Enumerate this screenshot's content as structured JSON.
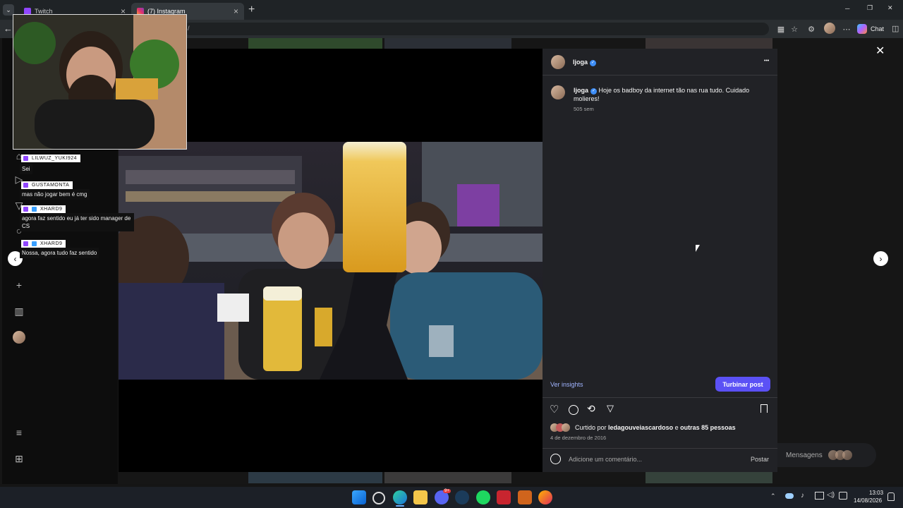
{
  "browser": {
    "tabs": [
      {
        "label": "Twitch"
      },
      {
        "label": "(7) Instagram"
      }
    ],
    "new_tab": "+",
    "url_fragment": "/",
    "chat_label": "Chat",
    "window_controls": {
      "minimize": "─",
      "restore": "❐",
      "close": "✕"
    }
  },
  "stream_chat": [
    {
      "user": "LILWUZ_YUKI924",
      "message": "Sei"
    },
    {
      "user": "GUSTAMONTA",
      "message": "mas não jogar bem é cmg"
    },
    {
      "user": "XHARD9",
      "message": "agora faz sentido eu já ter sido manager de CS"
    },
    {
      "user": "XHARD9",
      "message": "Nossa, agora tudo faz sentido"
    }
  ],
  "post": {
    "username": "ljoga",
    "caption": "Hoje os badboy da internet tão nas rua tudo. Cuidado molieres!",
    "caption_time": "505 sem",
    "insights_label": "Ver insights",
    "boost_label": "Turbinar post",
    "liked_prefix": "Curtido por",
    "liked_user": "ledagouveiascardoso",
    "liked_suffix": "e",
    "liked_others": "outras 85 pessoas",
    "date": "4 de dezembro de 2016",
    "comment_placeholder": "Adicione um comentário...",
    "post_button": "Postar",
    "more_icon": "•••"
  },
  "messages_pill": {
    "label": "Mensagens"
  },
  "taskbar": {
    "discord_badge": "9+",
    "time": "13:03",
    "date": "14/08/2026"
  },
  "colors": {
    "accent_blue": "#5b51f5",
    "link_blue": "#a0b4ff",
    "verified": "#3e8ef7",
    "panel_bg": "#212226"
  }
}
